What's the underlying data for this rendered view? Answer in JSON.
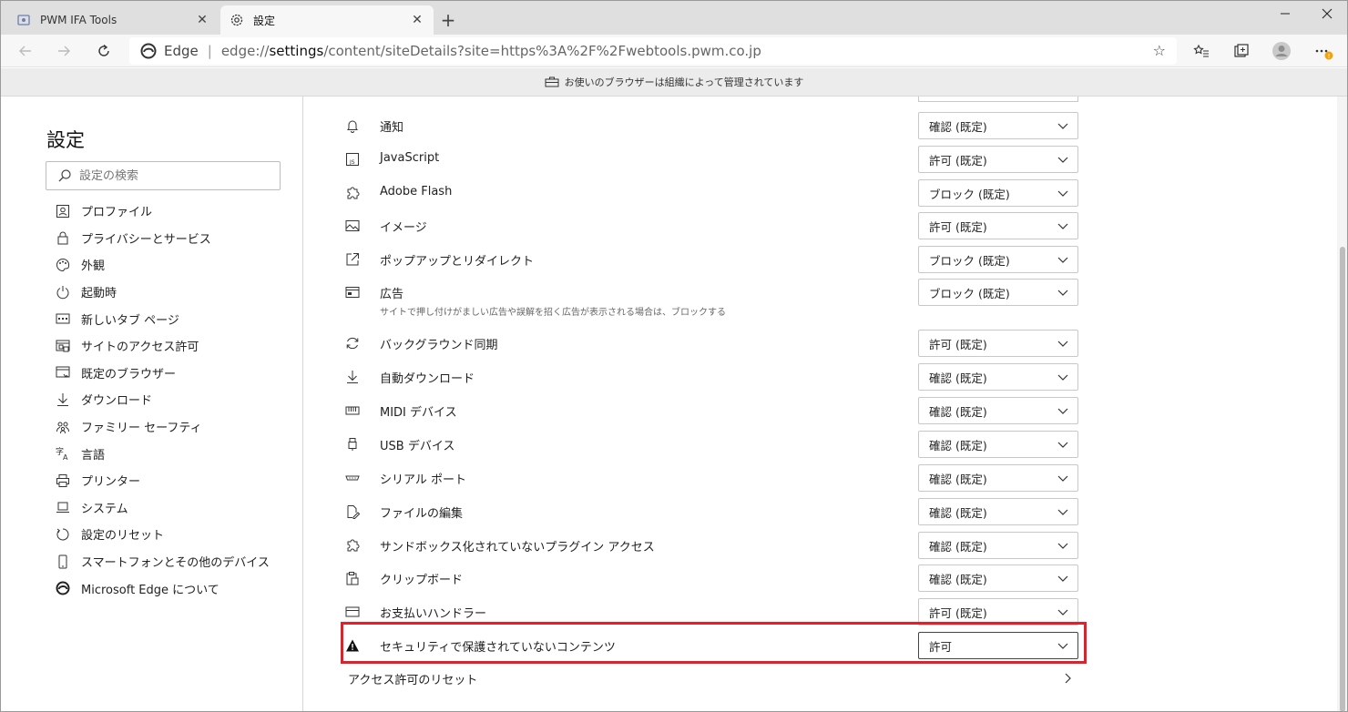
{
  "tabs": [
    {
      "title": "PWM IFA Tools",
      "close": "✕"
    },
    {
      "title": "設定",
      "close": "✕"
    }
  ],
  "toolbar": {
    "site_name": "Edge",
    "url_prefix": "edge://",
    "url_bold": "settings",
    "url_rest": "/content/siteDetails?site=https%3A%2F%2Fwebtools.pwm.co.jp"
  },
  "managed_notice": "お使いのブラウザーは組織によって管理されています",
  "sidebar": {
    "title": "設定",
    "search_placeholder": "設定の検索",
    "items": [
      {
        "label": "プロファイル",
        "icon": "profile-icon"
      },
      {
        "label": "プライバシーとサービス",
        "icon": "lock-icon"
      },
      {
        "label": "外観",
        "icon": "palette-icon"
      },
      {
        "label": "起動時",
        "icon": "power-icon"
      },
      {
        "label": "新しいタブ ページ",
        "icon": "new-tab-page-icon"
      },
      {
        "label": "サイトのアクセス許可",
        "icon": "site-permissions-icon"
      },
      {
        "label": "既定のブラウザー",
        "icon": "default-browser-icon"
      },
      {
        "label": "ダウンロード",
        "icon": "download-icon"
      },
      {
        "label": "ファミリー セーフティ",
        "icon": "family-icon"
      },
      {
        "label": "言語",
        "icon": "language-icon"
      },
      {
        "label": "プリンター",
        "icon": "printer-icon"
      },
      {
        "label": "システム",
        "icon": "system-icon"
      },
      {
        "label": "設定のリセット",
        "icon": "reset-icon"
      },
      {
        "label": "スマートフォンとその他のデバイス",
        "icon": "phone-icon"
      },
      {
        "label": "Microsoft Edge について",
        "icon": "edge-icon"
      }
    ]
  },
  "permissions": [
    {
      "label": "通知",
      "value": "確認 (既定)",
      "icon": "bell-icon"
    },
    {
      "label": "JavaScript",
      "value": "許可 (既定)",
      "icon": "javascript-icon"
    },
    {
      "label": "Adobe Flash",
      "value": "ブロック (既定)",
      "icon": "puzzle-icon"
    },
    {
      "label": "イメージ",
      "value": "許可 (既定)",
      "icon": "image-icon"
    },
    {
      "label": "ポップアップとリダイレクト",
      "value": "ブロック (既定)",
      "icon": "popup-icon"
    },
    {
      "label": "広告",
      "value": "ブロック (既定)",
      "icon": "ads-icon",
      "description": "サイトで押し付けがましい広告や誤解を招く広告が表示される場合は、ブロックする"
    },
    {
      "label": "バックグラウンド同期",
      "value": "許可 (既定)",
      "icon": "sync-icon"
    },
    {
      "label": "自動ダウンロード",
      "value": "確認 (既定)",
      "icon": "download-icon"
    },
    {
      "label": "MIDI デバイス",
      "value": "確認 (既定)",
      "icon": "midi-icon"
    },
    {
      "label": "USB デバイス",
      "value": "確認 (既定)",
      "icon": "usb-icon"
    },
    {
      "label": "シリアル ポート",
      "value": "確認 (既定)",
      "icon": "serial-port-icon"
    },
    {
      "label": "ファイルの編集",
      "value": "確認 (既定)",
      "icon": "file-edit-icon"
    },
    {
      "label": "サンドボックス化されていないプラグイン アクセス",
      "value": "確認 (既定)",
      "icon": "plugin-icon"
    },
    {
      "label": "クリップボード",
      "value": "確認 (既定)",
      "icon": "clipboard-icon"
    },
    {
      "label": "お支払いハンドラー",
      "value": "許可 (既定)",
      "icon": "payment-icon"
    },
    {
      "label": "セキュリティで保護されていないコンテンツ",
      "value": "許可",
      "icon": "warning-icon"
    }
  ],
  "reset_permissions": "アクセス許可のリセット",
  "colors": {
    "highlight": "#e0212b",
    "accent": "#0078d4"
  }
}
